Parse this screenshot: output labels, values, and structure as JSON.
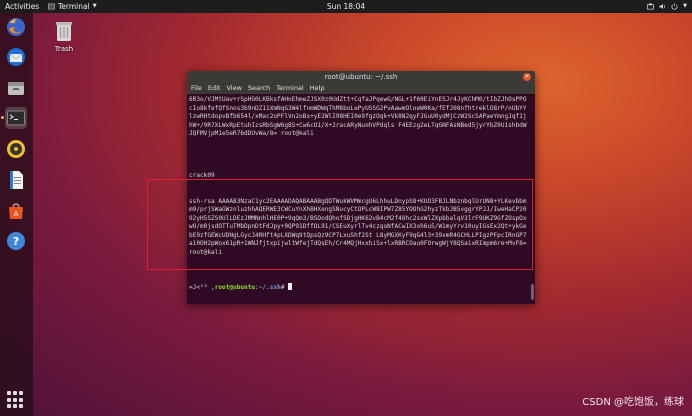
{
  "topbar": {
    "activities": "Activities",
    "app_name": "Terminal",
    "clock": "Sun 18:04"
  },
  "desktop": {
    "trash_label": "Trash"
  },
  "dock": {
    "items": [
      {
        "name": "firefox"
      },
      {
        "name": "thunderbird"
      },
      {
        "name": "files"
      },
      {
        "name": "terminal"
      },
      {
        "name": "rhythmbox"
      },
      {
        "name": "libreoffice-writer"
      },
      {
        "name": "ubuntu-software"
      },
      {
        "name": "help"
      }
    ]
  },
  "terminal": {
    "title": "root@ubuntu: ~/.ssh",
    "menu": [
      "File",
      "Edit",
      "View",
      "Search",
      "Terminal",
      "Help"
    ],
    "block1": "6R3o/VJMtUav+rSpHG0LKBksfAHnEhmeZJSX0z0UdZtt+CqfaJPqewG/NGL+1f60EiYnESJr4JyKChM0/tIbZJhOsPPOcIo8kfefQfSnos3b9nDZ11XmNqG3W4lfnmWDWqThM8boLePyUSSG2PvAawmOloeW0Ka/fEfJ08nfhtreklO8rP/nUbYYlzwRHtdopvBfb654l/xMac2oPFlVn2oBs+yE2WlI98HEI0e9fgzOqk+Vk8N2qyFJGuU0ydMjCzW2Sc5APaeYmngJqf1jhW+/9R7XLWxRpEtuhIzsRbSgW6g8S+Cw6cO1/X+2racARyNuohVPdqls F4EEzg2eLTqGNFAsNBed5jyrYbZ0U1shbdWJQFMVjpM1e5eR76dDUvWa/8= root@kali",
    "crack_line": "crack09",
    "block2": "ssh-rsa AAAAB3NzaC1yc2EAAAADAQABAAABgQDTWukWVMmcgU6LhhuLDnypS8+KUO3FBJLNbznbqlUrUN8+YLKevbbmm9/prjSWaGWznluzhhAQERWE3CWCuYnXhBHXengSNucyCtOPLcW8IPW7Z85YOOhG2hyzTkbJB5vggrYPJJ/IweHaCP2092yH5SZS0UlLDEzJMMNnhlHE0P+9qQm3/BSDodQhofSDjgHK62vB4cM2f48hc2sxWlZXpbbalqV3lrF9UKZ9GfZOspOxwO/m0jsdOTTuTMbDpnDtFdJpy+9QP91DffOL91/CSEuXyrlTv4czqoNfACwIX3oh6u5/W1myYrv10uyIGsEx2Qt+ykGebE9zfGEWcUDNgLGycJ4RHft4pLXDWq9tQpsQz9CP7LxuShf2St L8yMGXKyF9qG4l3+39xmR4GCHLLPIgzPFpcIRnGP7a10OH2pWox61pR+1WNJfjtxpijwltWfejTdQsEh/Cr4MQjHxxhiSx+lxRBRCOau0FOrwgWjY8QSaixRImpm6re+MvF8= root@kali",
    "prompt_prefix": "=J<²³ ,",
    "prompt_user": "root@ubuntu",
    "prompt_sep": ":",
    "prompt_path": "~/.ssh",
    "prompt_end": "# "
  },
  "watermark": "CSDN @吃饱饭，练球",
  "colors": {
    "highlight": "#e01e2e",
    "terminal_bg": "#300a24"
  }
}
